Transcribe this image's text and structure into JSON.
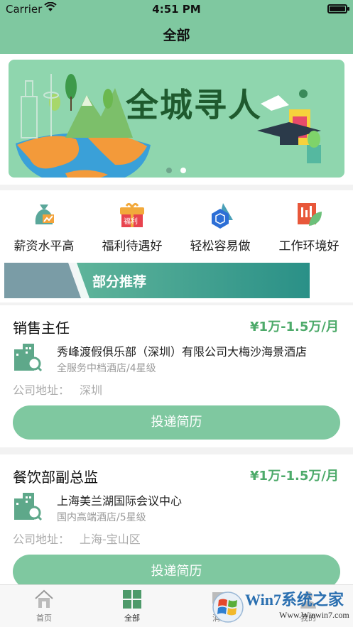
{
  "status_bar": {
    "carrier": "Carrier",
    "time": "4:51 PM"
  },
  "nav": {
    "title": "全部"
  },
  "banner": {
    "title": "全城寻人",
    "page_count": 2,
    "active_page": 2
  },
  "categories": [
    {
      "label": "薪资水平高",
      "icon": "money-bag-icon"
    },
    {
      "label": "福利待遇好",
      "icon": "gift-box-icon",
      "badge": "福利"
    },
    {
      "label": "轻松容易做",
      "icon": "cube-icon"
    },
    {
      "label": "工作环境好",
      "icon": "building-leaf-icon"
    }
  ],
  "section": {
    "title": "部分推荐"
  },
  "jobs": [
    {
      "title": "销售主任",
      "salary": "¥1万-1.5万/月",
      "company": "秀峰渡假俱乐部（深圳）有限公司大梅沙海景酒店",
      "company_type": "全服务中档酒店/4星级",
      "address_label": "公司地址：",
      "address": "深圳",
      "apply_label": "投递简历"
    },
    {
      "title": "餐饮部副总监",
      "salary": "¥1万-1.5万/月",
      "company": "上海美兰湖国际会议中心",
      "company_type": "国内高端酒店/5星级",
      "address_label": "公司地址：",
      "address": "上海-宝山区",
      "apply_label": "投递简历"
    }
  ],
  "tabs": [
    {
      "label": "首页",
      "icon": "home-icon"
    },
    {
      "label": "全部",
      "icon": "grid-icon",
      "active": true
    },
    {
      "label": "消息",
      "icon": "message-icon"
    },
    {
      "label": "我的",
      "icon": "profile-icon"
    }
  ],
  "watermark": {
    "text": "Win7系统之家",
    "url": "Www.Winwin7.com"
  },
  "colors": {
    "primary": "#7fc8a0",
    "salary": "#4daa6a",
    "section": "#2a9087"
  }
}
